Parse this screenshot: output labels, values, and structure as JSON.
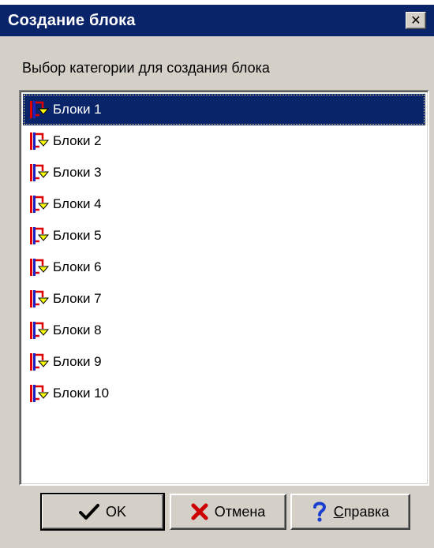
{
  "window": {
    "title": "Создание блока",
    "close_glyph": "✕"
  },
  "prompt_label": "Выбор категории для создания блока",
  "list": {
    "selected_index": 0,
    "items": [
      {
        "label": "Блоки 1",
        "icon": "block-category-icon"
      },
      {
        "label": "Блоки 2",
        "icon": "block-category-icon"
      },
      {
        "label": "Блоки 3",
        "icon": "block-category-icon"
      },
      {
        "label": "Блоки 4",
        "icon": "block-category-icon"
      },
      {
        "label": "Блоки 5",
        "icon": "block-category-icon"
      },
      {
        "label": "Блоки 6",
        "icon": "block-category-icon"
      },
      {
        "label": "Блоки 7",
        "icon": "block-category-icon"
      },
      {
        "label": "Блоки 8",
        "icon": "block-category-icon"
      },
      {
        "label": "Блоки 9",
        "icon": "block-category-icon"
      },
      {
        "label": "Блоки 10",
        "icon": "block-category-icon"
      }
    ]
  },
  "buttons": {
    "ok_label": "OK",
    "cancel_label": "Отмена",
    "help_accel": "С",
    "help_rest": "правка"
  },
  "colors": {
    "title_bar": "#0a246a",
    "face": "#d4d0c8",
    "selection": "#0a246a",
    "icon_red": "#e00000",
    "icon_blue": "#2020c0",
    "icon_yellow": "#ffff00"
  }
}
